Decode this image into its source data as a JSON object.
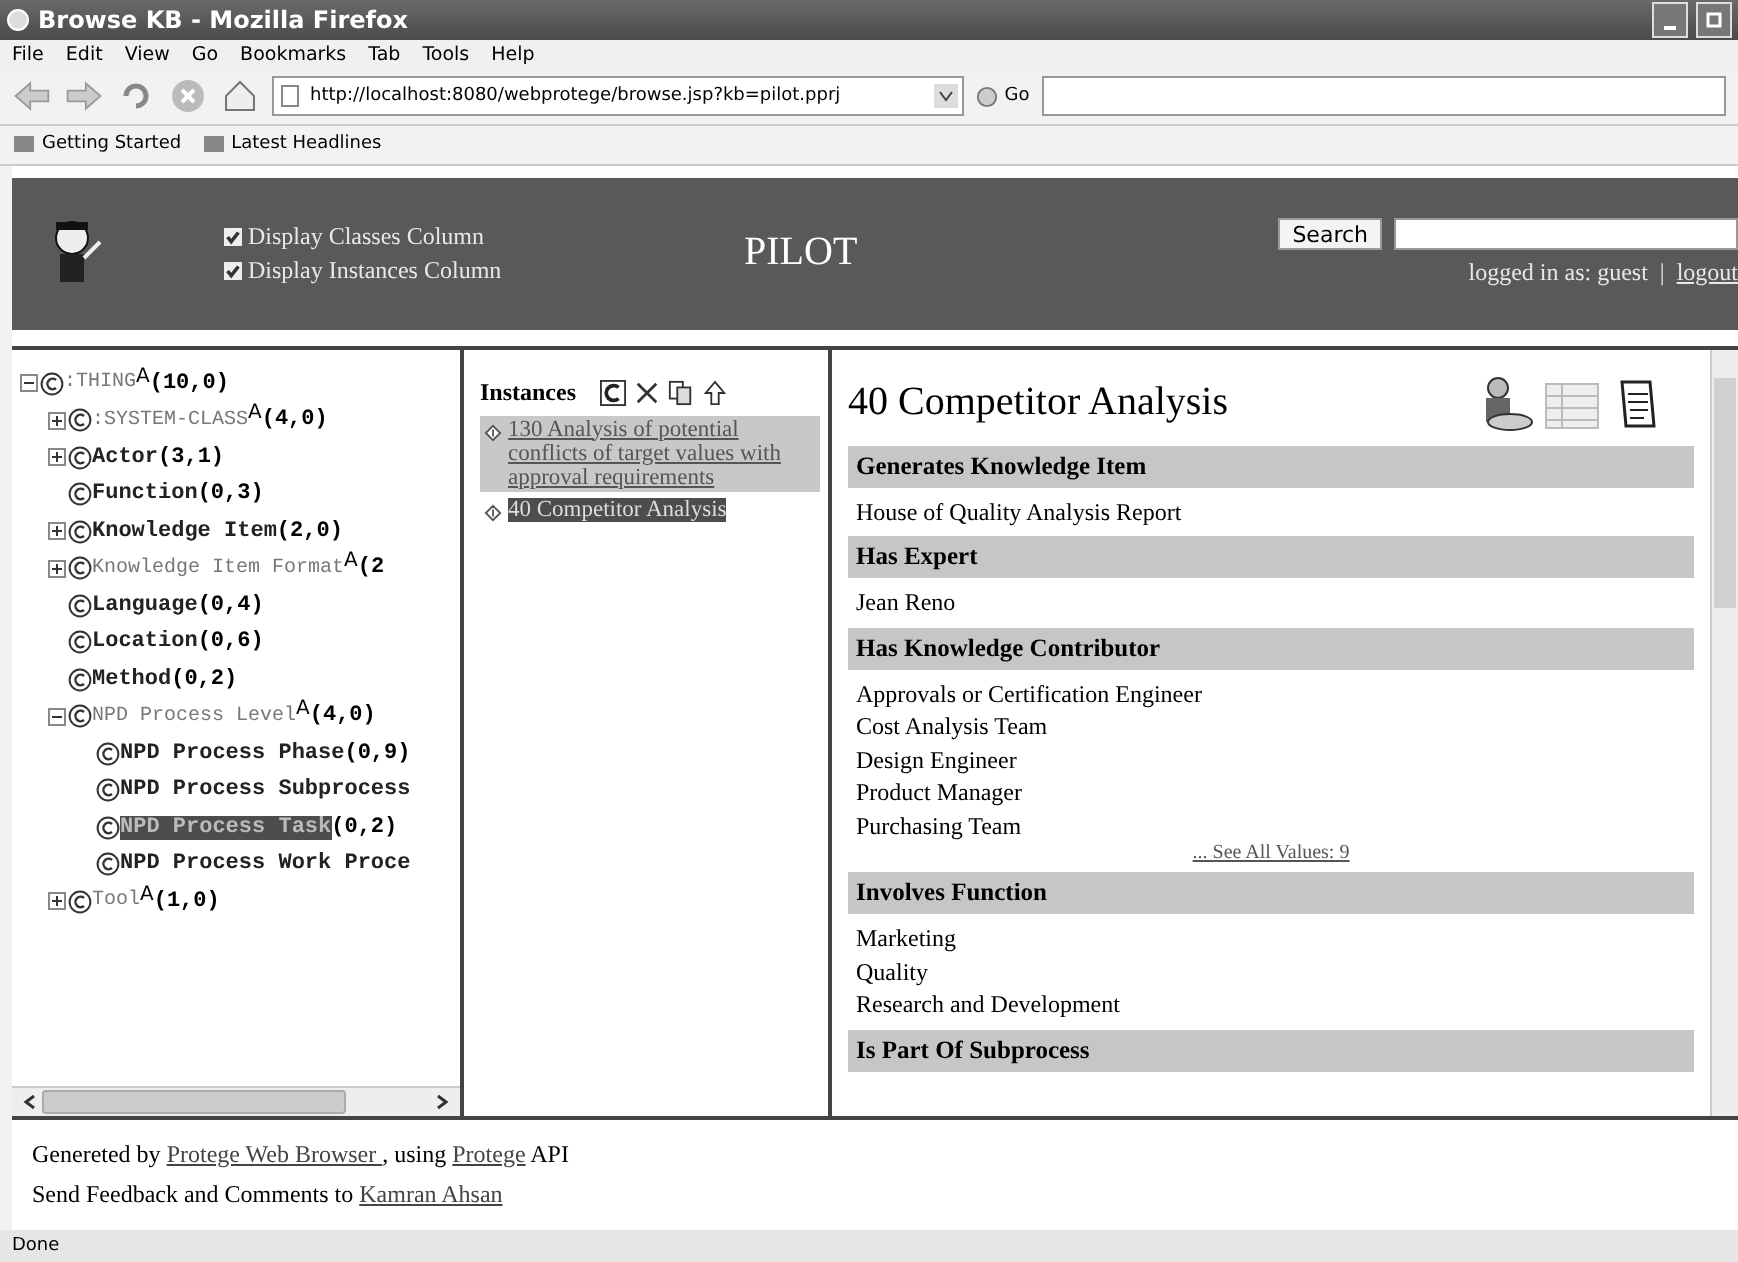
{
  "window": {
    "title": "Browse KB - Mozilla Firefox"
  },
  "menu": [
    "File",
    "Edit",
    "View",
    "Go",
    "Bookmarks",
    "Tab",
    "Tools",
    "Help"
  ],
  "address": {
    "value": "http://localhost:8080/webprotege/browse.jsp?kb=pilot.pprj",
    "go": "Go"
  },
  "bookmarks": [
    "Getting Started",
    "Latest Headlines"
  ],
  "header": {
    "options": [
      {
        "label": "Display Classes Column",
        "checked": true
      },
      {
        "label": "Display Instances Column",
        "checked": true
      }
    ],
    "title": "PILOT",
    "search_button": "Search",
    "logged_in": "logged in as: guest",
    "separator": "|",
    "logout": "logout"
  },
  "tree": [
    {
      "name": ":THING",
      "abstract": true,
      "marker": "A",
      "count": "(10,0)",
      "expanded": true,
      "selected": false,
      "children": [
        {
          "name": ":SYSTEM-CLASS",
          "abstract": true,
          "marker": "A",
          "count": "(4,0)",
          "expanded": false,
          "selected": false
        },
        {
          "name": "Actor",
          "abstract": false,
          "count": "(3,1)",
          "expanded": false,
          "selected": false
        },
        {
          "name": "Function",
          "abstract": false,
          "count": "(0,3)",
          "selected": false
        },
        {
          "name": "Knowledge Item",
          "abstract": false,
          "count": "(2,0)",
          "expanded": false,
          "selected": false
        },
        {
          "name": "Knowledge Item Format",
          "abstract": true,
          "marker": "A",
          "count": "(2",
          "expanded": false,
          "selected": false
        },
        {
          "name": "Language",
          "abstract": false,
          "count": "(0,4)",
          "selected": false
        },
        {
          "name": "Location",
          "abstract": false,
          "count": "(0,6)",
          "selected": false
        },
        {
          "name": "Method",
          "abstract": false,
          "count": "(0,2)",
          "selected": false
        },
        {
          "name": "NPD Process Level",
          "abstract": true,
          "marker": "A",
          "count": "(4,0)",
          "expanded": true,
          "selected": false,
          "children": [
            {
              "name": "NPD Process Phase",
              "abstract": false,
              "count": "(0,9)",
              "selected": false
            },
            {
              "name": "NPD Process Subprocess",
              "abstract": false,
              "selected": false
            },
            {
              "name": "NPD Process Task",
              "abstract": false,
              "count": "(0,2)",
              "selected": true
            },
            {
              "name": "NPD Process Work Proce",
              "abstract": false,
              "selected": false
            }
          ]
        },
        {
          "name": "Tool",
          "abstract": true,
          "marker": "A",
          "count": "(1,0)",
          "expanded": false,
          "selected": false
        }
      ]
    }
  ],
  "instances": {
    "heading": "Instances",
    "items": [
      {
        "label": "130 Analysis of potential conflicts of target values with approval requirements",
        "hovered": true,
        "selected": false
      },
      {
        "label": "40 Competitor Analysis",
        "hovered": false,
        "selected": true
      }
    ]
  },
  "detail": {
    "title": "40 Competitor Analysis",
    "sections": [
      {
        "heading": "Generates Knowledge Item",
        "values": [
          "House of Quality Analysis Report"
        ]
      },
      {
        "heading": "Has Expert",
        "values": [
          "Jean Reno"
        ]
      },
      {
        "heading": "Has Knowledge Contributor",
        "values": [
          "Approvals or Certification Engineer",
          "Cost Analysis Team",
          "Design Engineer",
          "Product Manager",
          "Purchasing Team"
        ],
        "more": "... See All Values: 9"
      },
      {
        "heading": "Involves Function",
        "values": [
          "Marketing",
          "Quality",
          "Research and Development"
        ]
      },
      {
        "heading": "Is Part Of Subprocess"
      }
    ]
  },
  "footer": [
    [
      {
        "text": "Genereted by "
      },
      {
        "text": "Protege Web Browser ",
        "link": true
      },
      {
        "text": ", using "
      },
      {
        "text": "Protege",
        "link": true
      },
      {
        "text": " API"
      }
    ],
    [
      {
        "text": "Send Feedback and Comments to "
      },
      {
        "text": "Kamran Ahsan",
        "link": true
      }
    ]
  ],
  "status_bar": "Done"
}
